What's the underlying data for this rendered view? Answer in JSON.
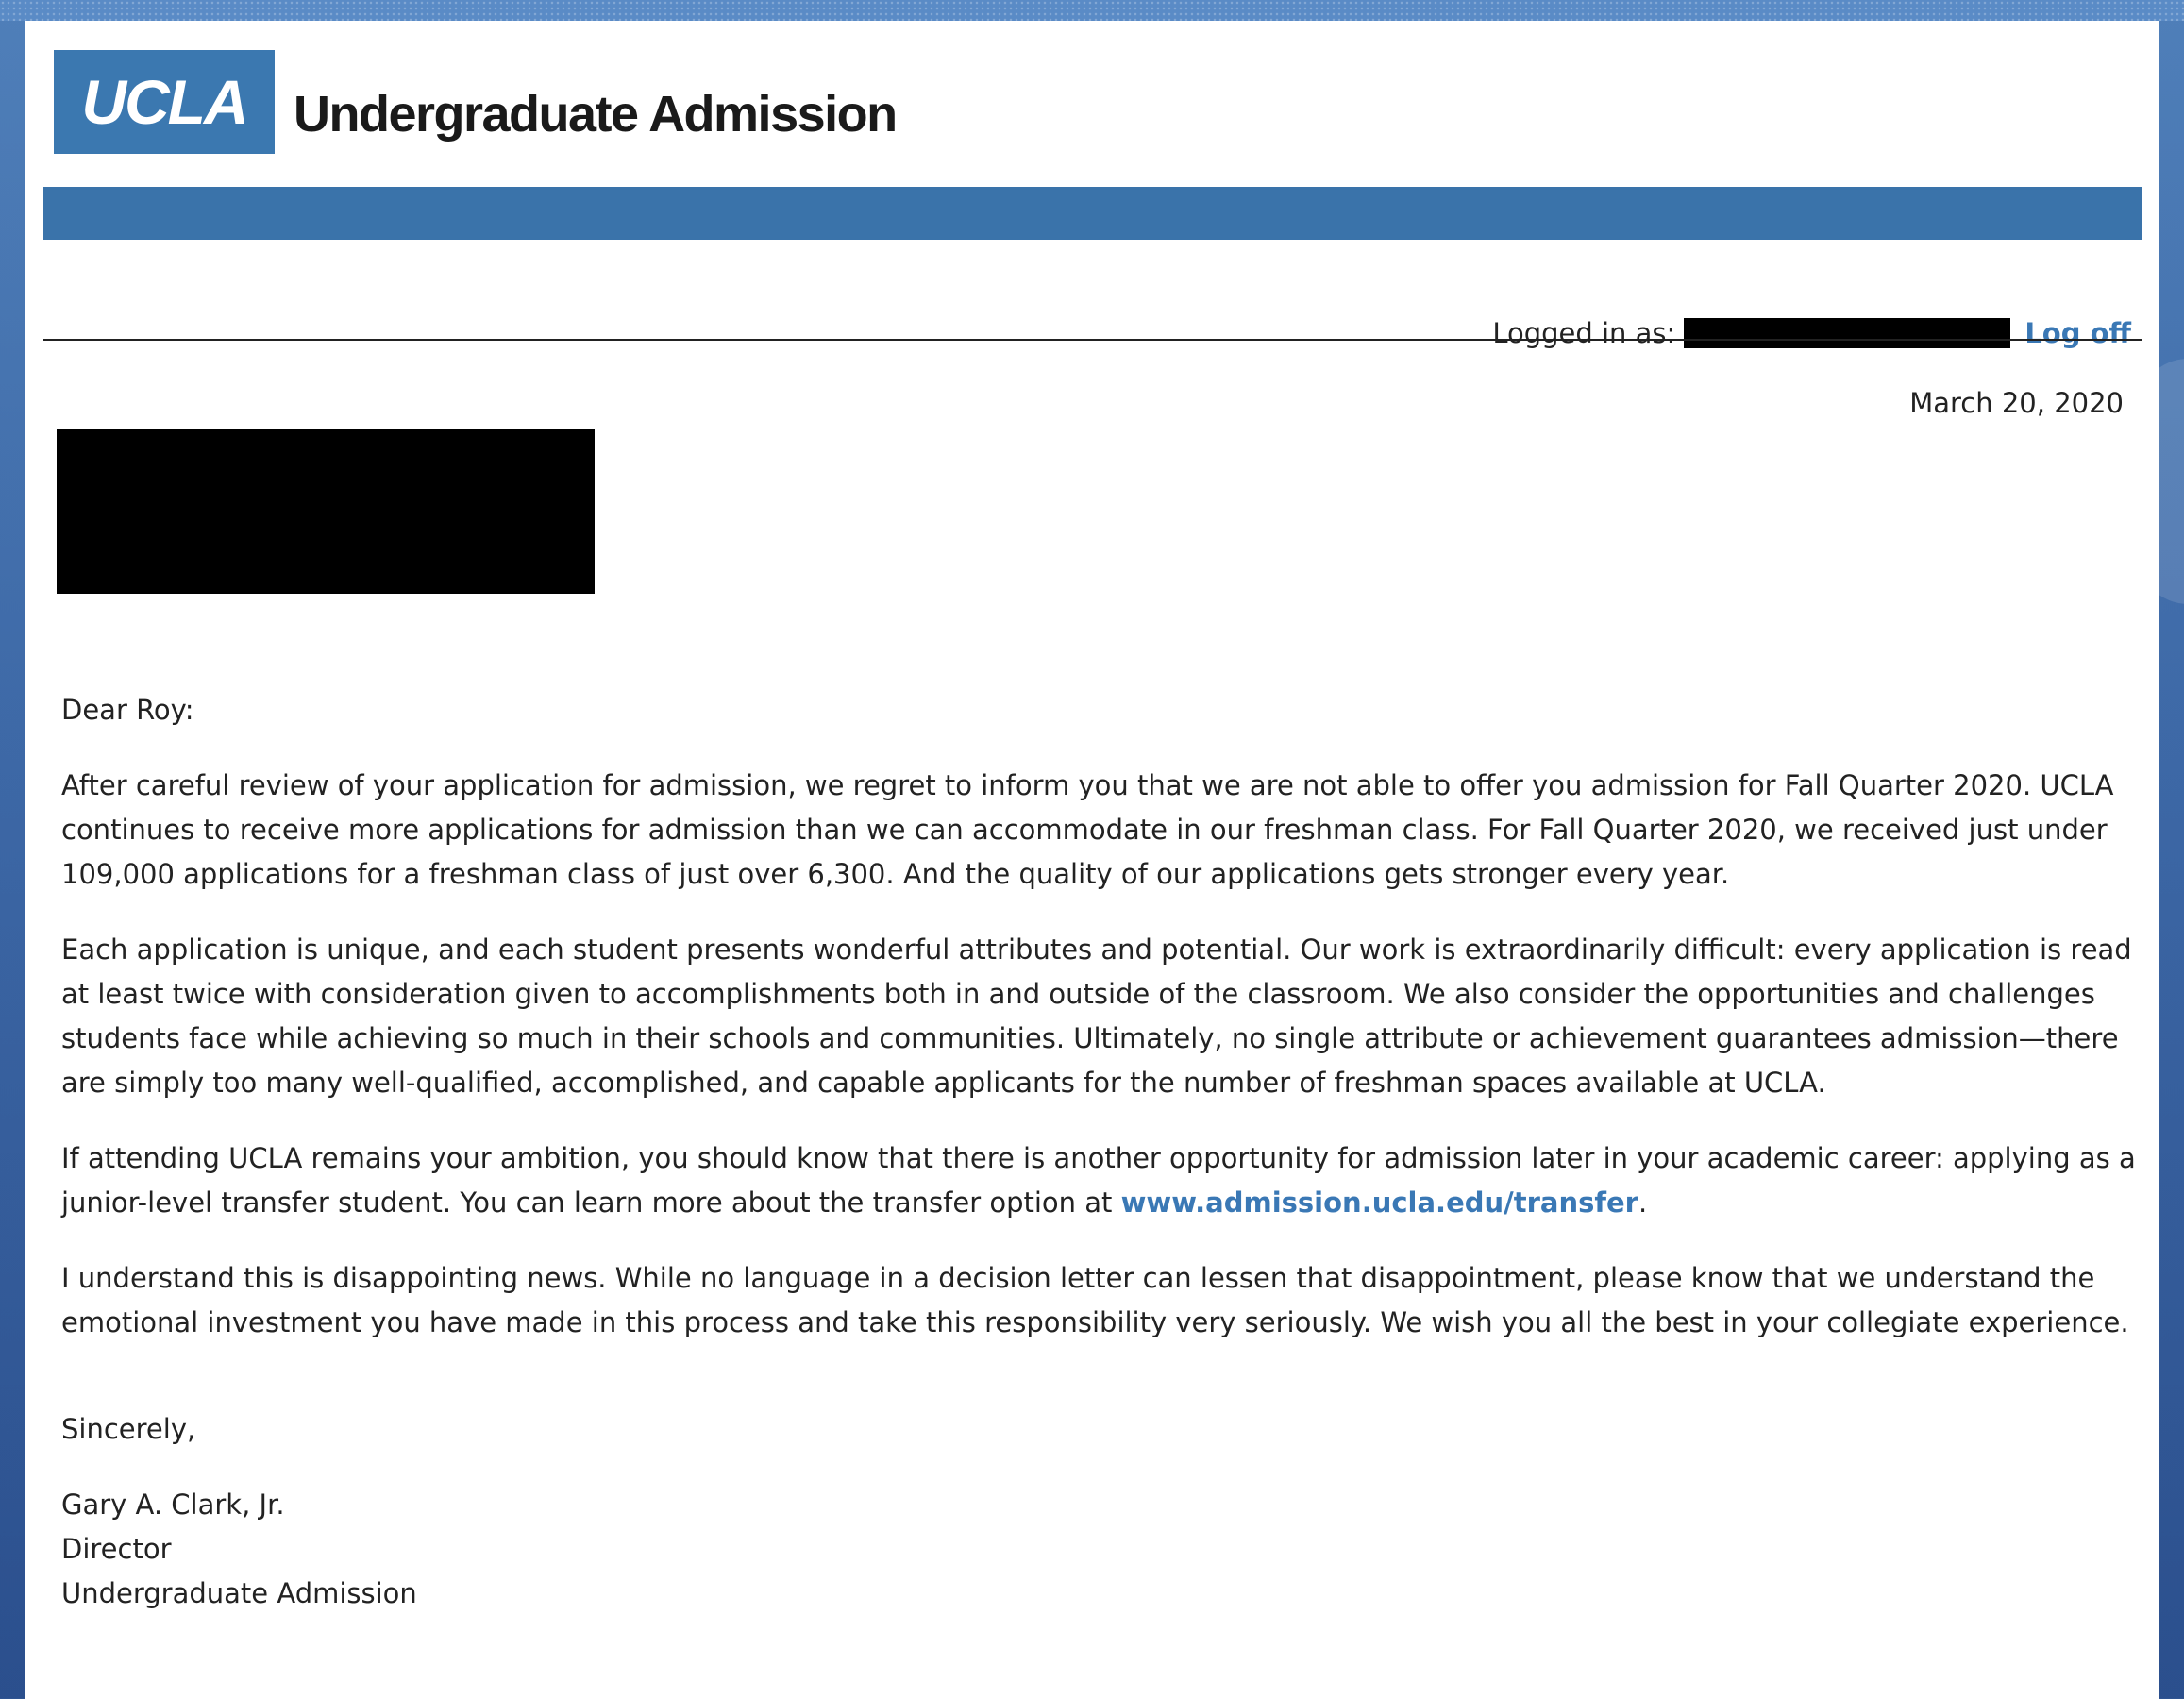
{
  "header": {
    "logo_text": "UCLA",
    "site_title": "Undergraduate Admission"
  },
  "user_bar": {
    "logged_in_label": "Logged in as:",
    "logoff_label": "Log off"
  },
  "letter": {
    "date": "March 20, 2020",
    "salutation": "Dear Roy:",
    "para1": "After careful review of your application for admission, we regret to inform you that we are not able to offer you admission for Fall Quarter 2020. UCLA continues to receive more applications for admission than we can accommodate in our freshman class. For Fall Quarter 2020, we received just under 109,000 applications for a freshman class of just over 6,300. And the quality of our applications gets stronger every year.",
    "para2": "Each application is unique, and each student presents wonderful attributes and potential. Our work is extraordinarily difficult: every application is read at least twice with consideration given to accomplishments both in and outside of the classroom. We also consider the opportunities and challenges students face while achieving so much in their schools and communities. Ultimately, no single attribute or achievement guarantees admission—there are simply too many well-qualified, accomplished, and capable applicants for the number of freshman spaces available at UCLA.",
    "para3_text": "If attending UCLA remains your ambition, you should know that there is another opportunity for admission later in your academic career: applying as a junior-level transfer student. You can learn more about the transfer option at ",
    "para3_link": "www.admission.ucla.edu/transfer",
    "para3_end": ".",
    "para4": "I understand this is disappointing news. While no language in a decision letter can lessen that disappointment, please know that we understand the emotional investment you have made in this process and take this responsibility very seriously. We wish you all the best in your collegiate experience.",
    "closing": "Sincerely,",
    "signature": {
      "name": "Gary A. Clark, Jr.",
      "title": "Director",
      "department": "Undergraduate Admission"
    }
  },
  "colors": {
    "brand_blue": "#3b78b0",
    "link_blue": "#3a78b5",
    "background_blue": "#3d68a6"
  }
}
